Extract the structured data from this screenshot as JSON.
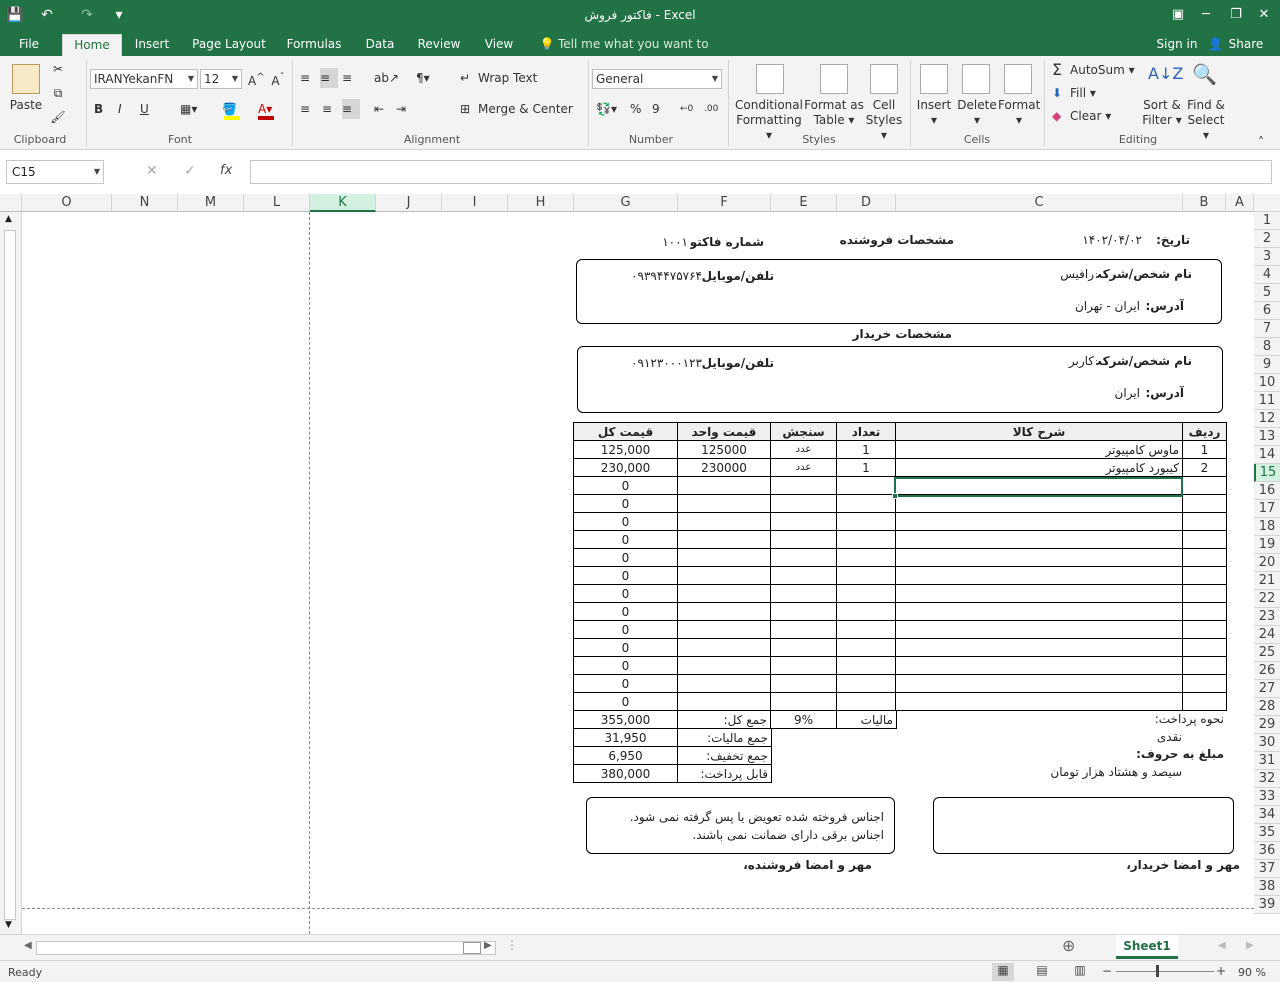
{
  "window": {
    "title": "فاکتور فروش - Excel"
  },
  "qat": {
    "save": "💾",
    "undo": "↶",
    "redo": "↷",
    "more": "▾"
  },
  "tabs": [
    "File",
    "Home",
    "Insert",
    "Page Layout",
    "Formulas",
    "Data",
    "Review",
    "View"
  ],
  "tell_me": "Tell me what you want to do...",
  "account": {
    "signin": "Sign in",
    "share": "Share"
  },
  "ribbon": {
    "clipboard": {
      "label": "Clipboard",
      "paste": "Paste"
    },
    "font": {
      "label": "Font",
      "name": "IRANYekanFN",
      "size": "12",
      "bold": "B",
      "italic": "I",
      "underline": "U"
    },
    "alignment": {
      "label": "Alignment",
      "wrap": "Wrap Text",
      "merge": "Merge & Center"
    },
    "number": {
      "label": "Number",
      "format": "General",
      "pct": "%",
      "comma": "9"
    },
    "styles": {
      "label": "Styles",
      "cond": "Conditional",
      "cond2": "Formatting",
      "fmt": "Format as",
      "fmt2": "Table",
      "cell": "Cell",
      "cell2": "Styles"
    },
    "cells": {
      "label": "Cells",
      "insert": "Insert",
      "delete": "Delete",
      "format": "Format"
    },
    "editing": {
      "label": "Editing",
      "autosum": "AutoSum",
      "fill": "Fill",
      "clear": "Clear",
      "sort": "Sort &",
      "sort2": "Filter",
      "find": "Find &",
      "find2": "Select"
    }
  },
  "namebox": "C15",
  "fx": "fx",
  "columns": [
    "O",
    "N",
    "M",
    "L",
    "K",
    "J",
    "I",
    "H",
    "G",
    "F",
    "E",
    "D",
    "C",
    "B",
    "A"
  ],
  "rows": [
    "1",
    "2",
    "3",
    "4",
    "5",
    "6",
    "7",
    "8",
    "9",
    "10",
    "11",
    "12",
    "13",
    "14",
    "15",
    "16",
    "17",
    "18",
    "19",
    "20",
    "21",
    "22",
    "23",
    "24",
    "25",
    "26",
    "27",
    "28",
    "29",
    "30",
    "31",
    "32",
    "33",
    "34",
    "35",
    "36",
    "37",
    "38",
    "39"
  ],
  "invoice": {
    "date_label": "تاریخ:",
    "date": "۱۴۰۲/۰۴/۰۲",
    "seller_title": "مشخصات فروشنده",
    "number_label": "شماره فاکتور:",
    "number": "۱۰۰۱",
    "seller_name_label": "نام شخص/شرکت:",
    "seller_name": "رافیس",
    "seller_phone_label": "تلفن/موبایل:",
    "seller_phone": "۰۹۳۹۴۴۷۵۷۶۴",
    "seller_addr_label": "آدرس:",
    "seller_addr": "ایران - تهران",
    "buyer_title": "مشخصات خریدار",
    "buyer_name_label": "نام شخص/شرکت:",
    "buyer_name": "کاربر",
    "buyer_phone_label": "تلفن/موبایل:",
    "buyer_phone": "۰۹۱۲۳۰۰۰۱۲۳",
    "buyer_addr_label": "آدرس:",
    "buyer_addr": "ایران",
    "headers": {
      "row": "ردیف",
      "desc": "شرح کالا",
      "qty": "تعداد",
      "unit": "سنجش",
      "price": "قیمت واحد",
      "total": "قیمت کل"
    },
    "items": [
      {
        "row": "1",
        "desc": "ماوس کامپیوتر",
        "qty": "1",
        "unit": "عدد",
        "price": "125000",
        "total": "125,000"
      },
      {
        "row": "2",
        "desc": "کیبورد کامپیوتر",
        "qty": "1",
        "unit": "عدد",
        "price": "230000",
        "total": "230,000"
      },
      {
        "row": "",
        "desc": "",
        "qty": "",
        "unit": "",
        "price": "",
        "total": "0"
      },
      {
        "row": "",
        "desc": "",
        "qty": "",
        "unit": "",
        "price": "",
        "total": "0"
      },
      {
        "row": "",
        "desc": "",
        "qty": "",
        "unit": "",
        "price": "",
        "total": "0"
      },
      {
        "row": "",
        "desc": "",
        "qty": "",
        "unit": "",
        "price": "",
        "total": "0"
      },
      {
        "row": "",
        "desc": "",
        "qty": "",
        "unit": "",
        "price": "",
        "total": "0"
      },
      {
        "row": "",
        "desc": "",
        "qty": "",
        "unit": "",
        "price": "",
        "total": "0"
      },
      {
        "row": "",
        "desc": "",
        "qty": "",
        "unit": "",
        "price": "",
        "total": "0"
      },
      {
        "row": "",
        "desc": "",
        "qty": "",
        "unit": "",
        "price": "",
        "total": "0"
      },
      {
        "row": "",
        "desc": "",
        "qty": "",
        "unit": "",
        "price": "",
        "total": "0"
      },
      {
        "row": "",
        "desc": "",
        "qty": "",
        "unit": "",
        "price": "",
        "total": "0"
      },
      {
        "row": "",
        "desc": "",
        "qty": "",
        "unit": "",
        "price": "",
        "total": "0"
      },
      {
        "row": "",
        "desc": "",
        "qty": "",
        "unit": "",
        "price": "",
        "total": "0"
      },
      {
        "row": "",
        "desc": "",
        "qty": "",
        "unit": "",
        "price": "",
        "total": "0"
      }
    ],
    "tax_label": "مالیات",
    "tax_rate": "9%",
    "sum_label": "جمع کل:",
    "sum": "355,000",
    "tax_sum_label": "جمع مالیات:",
    "tax_sum": "31,950",
    "discount_label": "جمع تخفیف:",
    "discount": "6,950",
    "payable_label": "قابل پرداخت:",
    "payable": "380,000",
    "payment_label": "نحوه پرداخت:",
    "payment": "نقدی",
    "words_label": "مبلغ به حروف:",
    "words": "سیصد و هشتاد هزار تومان",
    "note1": "اجناس فروخته شده تعویض یا پس گرفته نمی شود.",
    "note2": "اجناس برقی دارای ضمانت نمی باشند.",
    "seller_sign": "مهر و امضا فروشنده،",
    "buyer_sign": "مهر و امضا خریدار،"
  },
  "sheet": {
    "name": "Sheet1"
  },
  "status": {
    "ready": "Ready",
    "zoom": "90 %"
  }
}
